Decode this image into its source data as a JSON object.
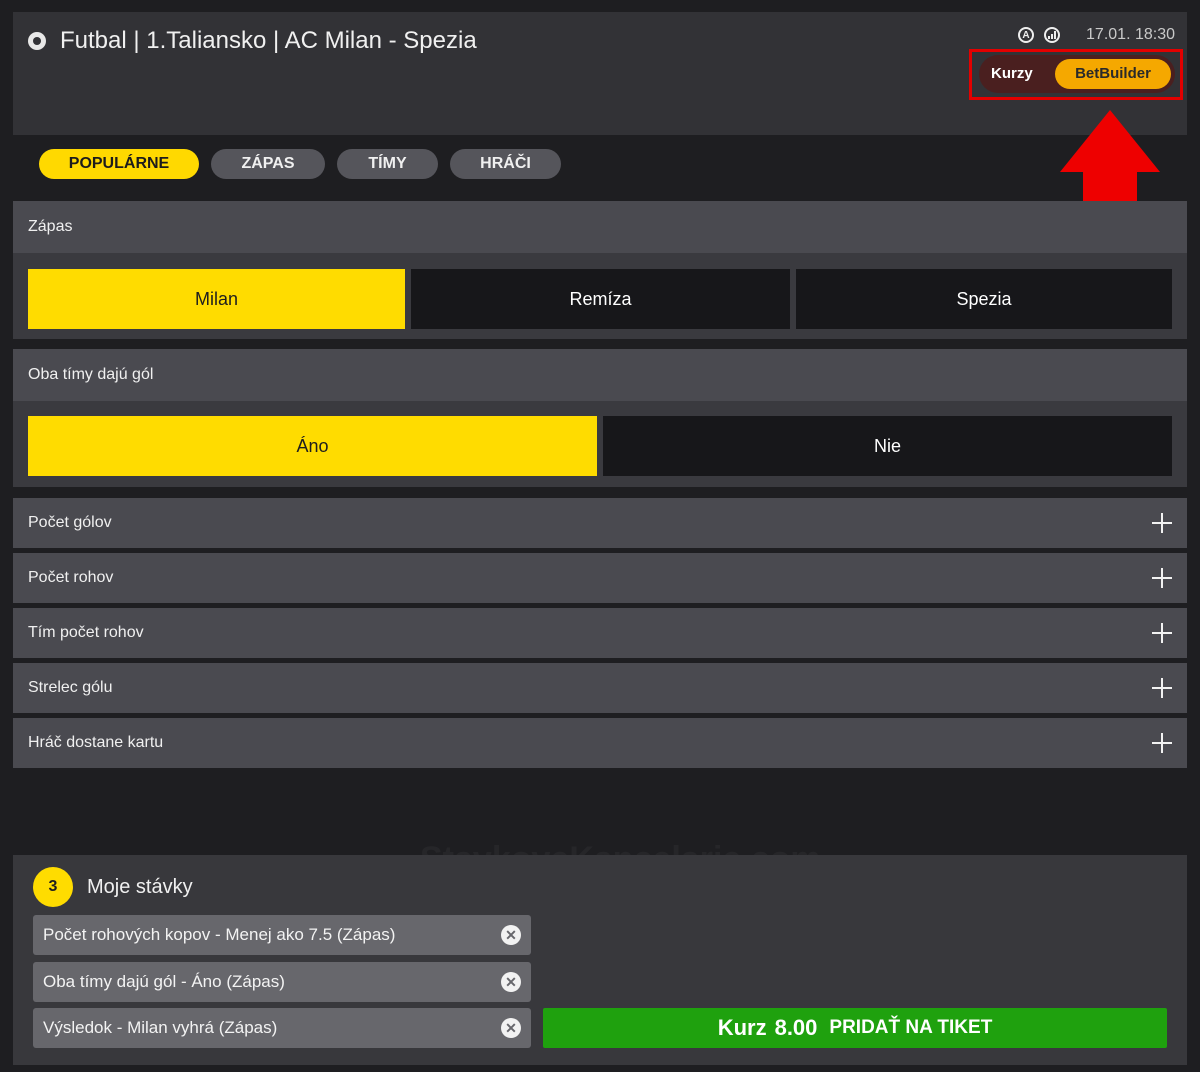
{
  "header": {
    "title": "Futbal | 1.Taliansko | AC Milan - Spezia",
    "datetime": "17.01. 18:30",
    "icons": [
      "sport-soccer-icon",
      "a-badge-icon",
      "stats-icon"
    ]
  },
  "toggle": {
    "left_label": "Kurzy",
    "right_label": "BetBuilder",
    "active": "BetBuilder"
  },
  "tabs": [
    {
      "label": "POPULÁRNE",
      "active": true
    },
    {
      "label": "ZÁPAS",
      "active": false
    },
    {
      "label": "TÍMY",
      "active": false
    },
    {
      "label": "HRÁČI",
      "active": false
    }
  ],
  "sections": {
    "match": {
      "title": "Zápas",
      "options": [
        {
          "label": "Milan",
          "selected": true
        },
        {
          "label": "Remíza",
          "selected": false
        },
        {
          "label": "Spezia",
          "selected": false
        }
      ]
    },
    "btts": {
      "title": "Oba tímy dajú gól",
      "options": [
        {
          "label": "Áno",
          "selected": true
        },
        {
          "label": "Nie",
          "selected": false
        }
      ]
    }
  },
  "markets": [
    "Počet gólov",
    "Počet rohov",
    "Tím počet rohov",
    "Strelec gólu",
    "Hráč dostane kartu"
  ],
  "betslip": {
    "count": "3",
    "title": "Moje stávky",
    "bets": [
      "Počet rohových kopov - Menej ako 7.5 (Zápas)",
      "Oba tímy dajú gól - Áno (Zápas)",
      "Výsledok - Milan vyhrá (Zápas)"
    ],
    "odds_label": "Kurz",
    "odds_value": "8.00",
    "add_label": "PRIDAŤ NA TIKET"
  },
  "watermark": "StavkoveKancelarie.com",
  "colors": {
    "accent": "#ffdc00",
    "toggle_active": "#f5a800",
    "add_button": "#1fa10e",
    "highlight_box": "#e30000"
  }
}
